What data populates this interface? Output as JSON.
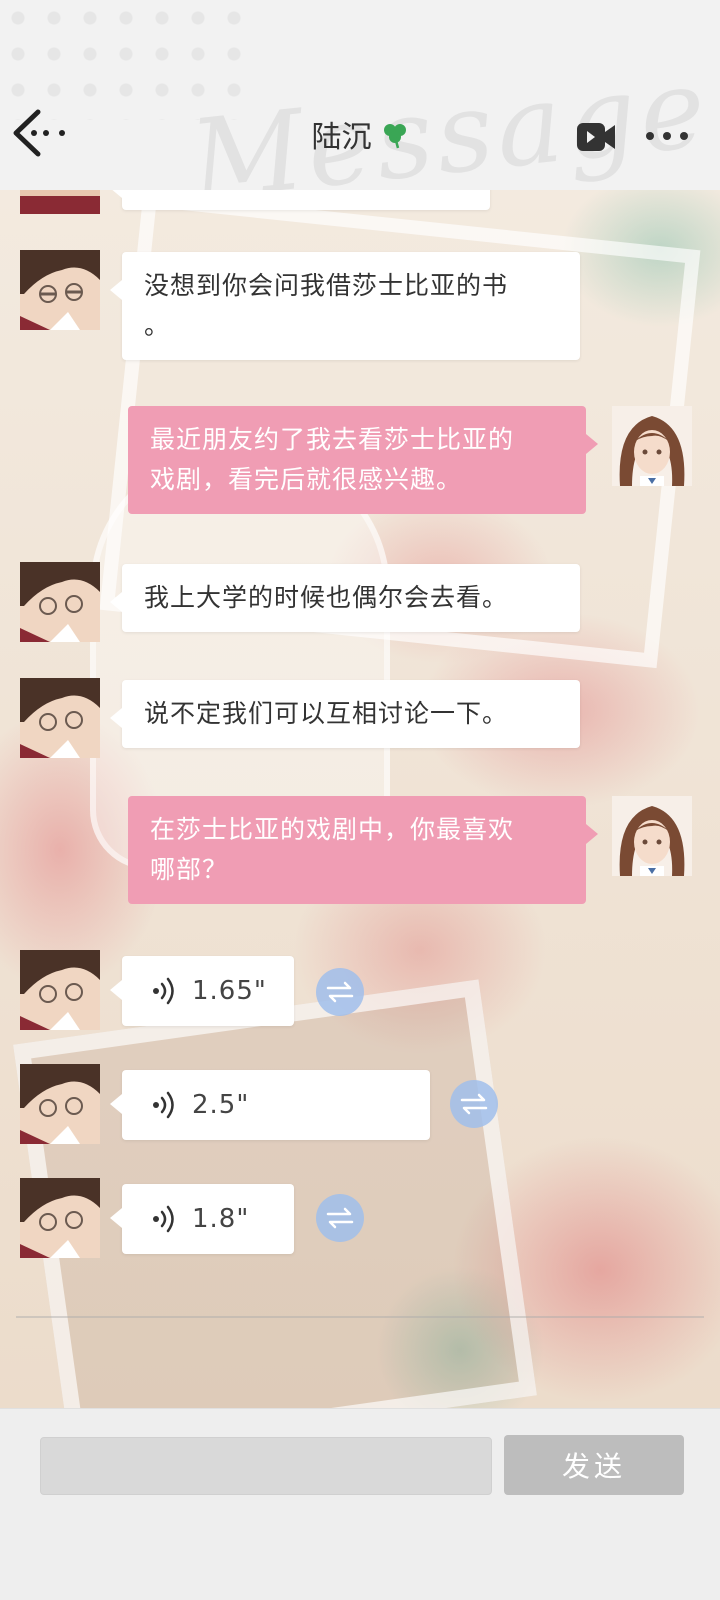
{
  "header": {
    "title": "陆沉",
    "watermark": "Message",
    "icons": {
      "back": "back-arrow-icon",
      "badge": "clover-icon",
      "video": "video-call-icon",
      "more": "more-dots-icon"
    }
  },
  "messages": [
    {
      "side": "left",
      "type": "text",
      "text": "没想到你会问我借莎士比亚的书\n。"
    },
    {
      "side": "right",
      "type": "text",
      "text": "最近朋友约了我去看莎士比亚的\n戏剧，看完后就很感兴趣。"
    },
    {
      "side": "left",
      "type": "text",
      "text": "我上大学的时候也偶尔会去看。"
    },
    {
      "side": "left",
      "type": "text",
      "text": "说不定我们可以互相讨论一下。"
    },
    {
      "side": "right",
      "type": "text",
      "text": "在莎士比亚的戏剧中，你最喜欢\n哪部？"
    },
    {
      "side": "left",
      "type": "voice",
      "duration": "1.65\""
    },
    {
      "side": "left",
      "type": "voice",
      "duration": "2.5\""
    },
    {
      "side": "left",
      "type": "voice",
      "duration": "1.8\""
    }
  ],
  "input": {
    "value": "",
    "placeholder": ""
  },
  "send_button": {
    "label": "发送"
  },
  "colors": {
    "incoming_bubble": "#ffffff",
    "outgoing_bubble": "#f09db4",
    "send_button": "#bdbdbd",
    "translate_button": "#a0bee9"
  }
}
